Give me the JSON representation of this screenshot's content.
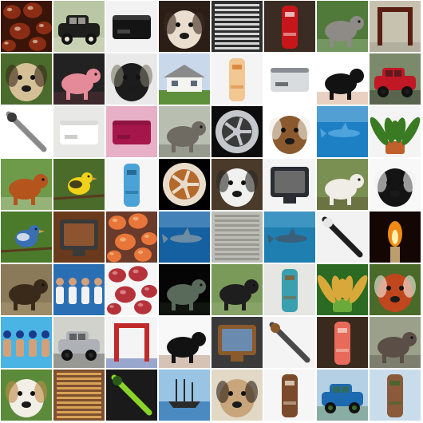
{
  "grid": {
    "rows": 8,
    "columns": 8,
    "background": "#ffffff",
    "tiles": [
      {
        "name": "chestnuts-image",
        "bg": "#3a1409",
        "fg": "#8a2d14",
        "accent": "#e8c9b0",
        "kind": "blobs"
      },
      {
        "name": "vintage-car-image",
        "bg": "#b9c7a4",
        "fg": "#1e1e1c",
        "accent": "#e8e4d8",
        "kind": "car"
      },
      {
        "name": "black-device-image",
        "bg": "#f2f2f2",
        "fg": "#141414",
        "accent": "#5a5a5a",
        "kind": "box"
      },
      {
        "name": "poodle-image",
        "bg": "#2a1e16",
        "fg": "#eadfce",
        "accent": "#3a2a1f",
        "kind": "face"
      },
      {
        "name": "radiator-grille-image",
        "bg": "#222222",
        "fg": "#e6e6e6",
        "accent": "#777777",
        "kind": "stripes"
      },
      {
        "name": "red-mailbox-image",
        "bg": "#3a2c22",
        "fg": "#c6161a",
        "accent": "#f4e3e0",
        "kind": "pillar"
      },
      {
        "name": "wolfhound-image",
        "bg": "#4f7a3a",
        "fg": "#8e8a85",
        "accent": "#c9d7b9",
        "kind": "animal"
      },
      {
        "name": "wooden-gallows-image",
        "bg": "#c7c1b0",
        "fg": "#5a1e12",
        "accent": "#9a9a8c",
        "kind": "frame"
      },
      {
        "name": "gibbon-image",
        "bg": "#4a6b2b",
        "fg": "#d4bf97",
        "accent": "#3a2a1a",
        "kind": "face"
      },
      {
        "name": "piggy-bank-image",
        "bg": "#222222",
        "fg": "#e48a98",
        "accent": "#7d3a44",
        "kind": "animal"
      },
      {
        "name": "lemur-image",
        "bg": "#e9e9e9",
        "fg": "#1c1c1c",
        "accent": "#7a7a6a",
        "kind": "face"
      },
      {
        "name": "white-house-image",
        "bg": "#c9d8ea",
        "fg": "#f4f4f1",
        "accent": "#5e8f3b",
        "kind": "house"
      },
      {
        "name": "lotion-tube-image",
        "bg": "#f4f4f4",
        "fg": "#f2c792",
        "accent": "#d67a2c",
        "kind": "pillar"
      },
      {
        "name": "projector-image",
        "bg": "#ffffff",
        "fg": "#d9dcdf",
        "accent": "#3b3f45",
        "kind": "box"
      },
      {
        "name": "bernese-dog-image",
        "bg": "#ffffff",
        "fg": "#121212",
        "accent": "#b8642e",
        "kind": "animal"
      },
      {
        "name": "red-scooter-image",
        "bg": "#7a8a6a",
        "fg": "#c01824",
        "accent": "#1c1c1c",
        "kind": "car"
      },
      {
        "name": "corkscrew-image",
        "bg": "#ffffff",
        "fg": "#8a8a8a",
        "accent": "#3a3a3a",
        "kind": "diag"
      },
      {
        "name": "toilet-image",
        "bg": "#e8e8e6",
        "fg": "#ffffff",
        "accent": "#b8b8b4",
        "kind": "box"
      },
      {
        "name": "folded-towel-image",
        "bg": "#e7b0c6",
        "fg": "#a5174a",
        "accent": "#7a0f35",
        "kind": "box"
      },
      {
        "name": "elephants-image",
        "bg": "#b9bfb0",
        "fg": "#6f6a62",
        "accent": "#4a463f",
        "kind": "animal"
      },
      {
        "name": "alloy-wheel-image",
        "bg": "#0c0c0c",
        "fg": "#c4c7cb",
        "accent": "#3a3a3a",
        "kind": "wheel"
      },
      {
        "name": "beagle-image",
        "bg": "#ffffff",
        "fg": "#8a5a2e",
        "accent": "#f2eee8",
        "kind": "face"
      },
      {
        "name": "shark-underwater-image",
        "bg": "#1d7fc4",
        "fg": "#4ea3dc",
        "accent": "#b7dcf4",
        "kind": "water"
      },
      {
        "name": "potted-plant-image",
        "bg": "#f4f4f4",
        "fg": "#3a7a22",
        "accent": "#c0602a",
        "kind": "plant"
      },
      {
        "name": "saint-bernard-image",
        "bg": "#6e9b4a",
        "fg": "#b6541e",
        "accent": "#f2ece2",
        "kind": "animal"
      },
      {
        "name": "goldfinch-image",
        "bg": "#4a6b2a",
        "fg": "#f0d21a",
        "accent": "#1a1a1a",
        "kind": "bird"
      },
      {
        "name": "teapot-image",
        "bg": "#f6f6f6",
        "fg": "#4aa2d6",
        "accent": "#1c5b85",
        "kind": "pillar"
      },
      {
        "name": "nautilus-shell-image",
        "bg": "#000000",
        "fg": "#e9dccb",
        "accent": "#b36a2c",
        "kind": "wheel"
      },
      {
        "name": "husky-image",
        "bg": "#4a3a2a",
        "fg": "#f0f0ee",
        "accent": "#2a2a2a",
        "kind": "face"
      },
      {
        "name": "crt-television-image",
        "bg": "#f4f4f4",
        "fg": "#6a6a6a",
        "accent": "#2a2e33",
        "kind": "tv"
      },
      {
        "name": "pointer-dog-image",
        "bg": "#7a8f52",
        "fg": "#f0ece6",
        "accent": "#4a3422",
        "kind": "animal"
      },
      {
        "name": "boston-terrier-image",
        "bg": "#f8f8f8",
        "fg": "#141414",
        "accent": "#f2f2f2",
        "kind": "face"
      },
      {
        "name": "blue-jay-image",
        "bg": "#4a7a2a",
        "fg": "#3a6fb4",
        "accent": "#f2f2f2",
        "kind": "bird"
      },
      {
        "name": "entertainment-center-image",
        "bg": "#6a3a1c",
        "fg": "#8d5430",
        "accent": "#3a3a3a",
        "kind": "tv"
      },
      {
        "name": "coral-image",
        "bg": "#6a3a2a",
        "fg": "#e8763a",
        "accent": "#f2c28a",
        "kind": "blobs"
      },
      {
        "name": "hammerhead-shark-image",
        "bg": "#1460a0",
        "fg": "#6c8ca4",
        "accent": "#9cc4e4",
        "kind": "water"
      },
      {
        "name": "shower-curtain-image",
        "bg": "#b8b8b2",
        "fg": "#8f8f88",
        "accent": "#dcdcd6",
        "kind": "stripes"
      },
      {
        "name": "shark-swimming-image",
        "bg": "#1e7fb0",
        "fg": "#3a5f7a",
        "accent": "#7ac0e2",
        "kind": "water"
      },
      {
        "name": "racket-image",
        "bg": "#f2f2f2",
        "fg": "#1e1e1e",
        "accent": "#e6e6e6",
        "kind": "diag"
      },
      {
        "name": "candle-flame-image",
        "bg": "#140602",
        "fg": "#f08a14",
        "accent": "#fff2b0",
        "kind": "flame"
      },
      {
        "name": "porcupine-image",
        "bg": "#8a7a5a",
        "fg": "#3a2a1a",
        "accent": "#c9b48a",
        "kind": "animal"
      },
      {
        "name": "volleyball-image",
        "bg": "#2a6fb4",
        "fg": "#d4a07a",
        "accent": "#f2f2f2",
        "kind": "people"
      },
      {
        "name": "figs-image",
        "bg": "#f6f6f6",
        "fg": "#b5323a",
        "accent": "#e6a0a0",
        "kind": "blobs"
      },
      {
        "name": "sea-turtle-image",
        "bg": "#050505",
        "fg": "#5a6a5a",
        "accent": "#2a3a2a",
        "kind": "animal"
      },
      {
        "name": "water-buffalo-image",
        "bg": "#7a9a5a",
        "fg": "#1e1e1e",
        "accent": "#a6b88a",
        "kind": "animal"
      },
      {
        "name": "mop-closet-image",
        "bg": "#e6e6e2",
        "fg": "#3aa0b0",
        "accent": "#8a5a2a",
        "kind": "pillar"
      },
      {
        "name": "pineapple-image",
        "bg": "#2a6a22",
        "fg": "#d9a83a",
        "accent": "#6aaa3a",
        "kind": "plant"
      },
      {
        "name": "red-panda-image",
        "bg": "#4a6a2a",
        "fg": "#c0461e",
        "accent": "#f2eee6",
        "kind": "face"
      },
      {
        "name": "swimmers-image",
        "bg": "#4ab4e4",
        "fg": "#1a3a8a",
        "accent": "#d4a07a",
        "kind": "people"
      },
      {
        "name": "silver-sedan-image",
        "bg": "#d2d2cc",
        "fg": "#aeb2b6",
        "accent": "#2a2a2a",
        "kind": "car"
      },
      {
        "name": "hurdle-jumper-image",
        "bg": "#f4f4f4",
        "fg": "#c02a2a",
        "accent": "#2a4aa0",
        "kind": "frame"
      },
      {
        "name": "rottweiler-image",
        "bg": "#f8f8f8",
        "fg": "#121212",
        "accent": "#8a4a1e",
        "kind": "animal"
      },
      {
        "name": "computer-desk-image",
        "bg": "#3a3a3a",
        "fg": "#6a8ab0",
        "accent": "#8a5a2a",
        "kind": "tv"
      },
      {
        "name": "revolver-image",
        "bg": "#f4f4f4",
        "fg": "#4a4a4a",
        "accent": "#8a5a2a",
        "kind": "diag"
      },
      {
        "name": "mushroom-image",
        "bg": "#3a2a1e",
        "fg": "#e86a5a",
        "accent": "#f2d2c2",
        "kind": "pillar"
      },
      {
        "name": "wombat-image",
        "bg": "#9aa08a",
        "fg": "#5a4e46",
        "accent": "#3a322e",
        "kind": "animal"
      },
      {
        "name": "clumber-spaniel-image",
        "bg": "#5a8a3a",
        "fg": "#f2efe6",
        "accent": "#c08a4a",
        "kind": "face"
      },
      {
        "name": "bakery-shelves-image",
        "bg": "#6a3a1a",
        "fg": "#d49a4a",
        "accent": "#f2d2a0",
        "kind": "stripes"
      },
      {
        "name": "green-snake-image",
        "bg": "#1a1a1a",
        "fg": "#8ad42a",
        "accent": "#2a5a1a",
        "kind": "diag"
      },
      {
        "name": "sailing-ship-image",
        "bg": "#9ac4e4",
        "fg": "#2a2a2a",
        "accent": "#4a8ac0",
        "kind": "ship"
      },
      {
        "name": "pug-image",
        "bg": "#e2d8c6",
        "fg": "#c8a57a",
        "accent": "#2a1e16",
        "kind": "face"
      },
      {
        "name": "ceramic-jug-image",
        "bg": "#f6f6f6",
        "fg": "#7a4a2a",
        "accent": "#e8dccb",
        "kind": "pillar"
      },
      {
        "name": "blue-truck-image",
        "bg": "#b4d0e4",
        "fg": "#1e6ab0",
        "accent": "#3a6a2a",
        "kind": "car"
      },
      {
        "name": "totem-pole-image",
        "bg": "#c8dcec",
        "fg": "#8a5a3a",
        "accent": "#3a6a2a",
        "kind": "pillar"
      }
    ]
  }
}
